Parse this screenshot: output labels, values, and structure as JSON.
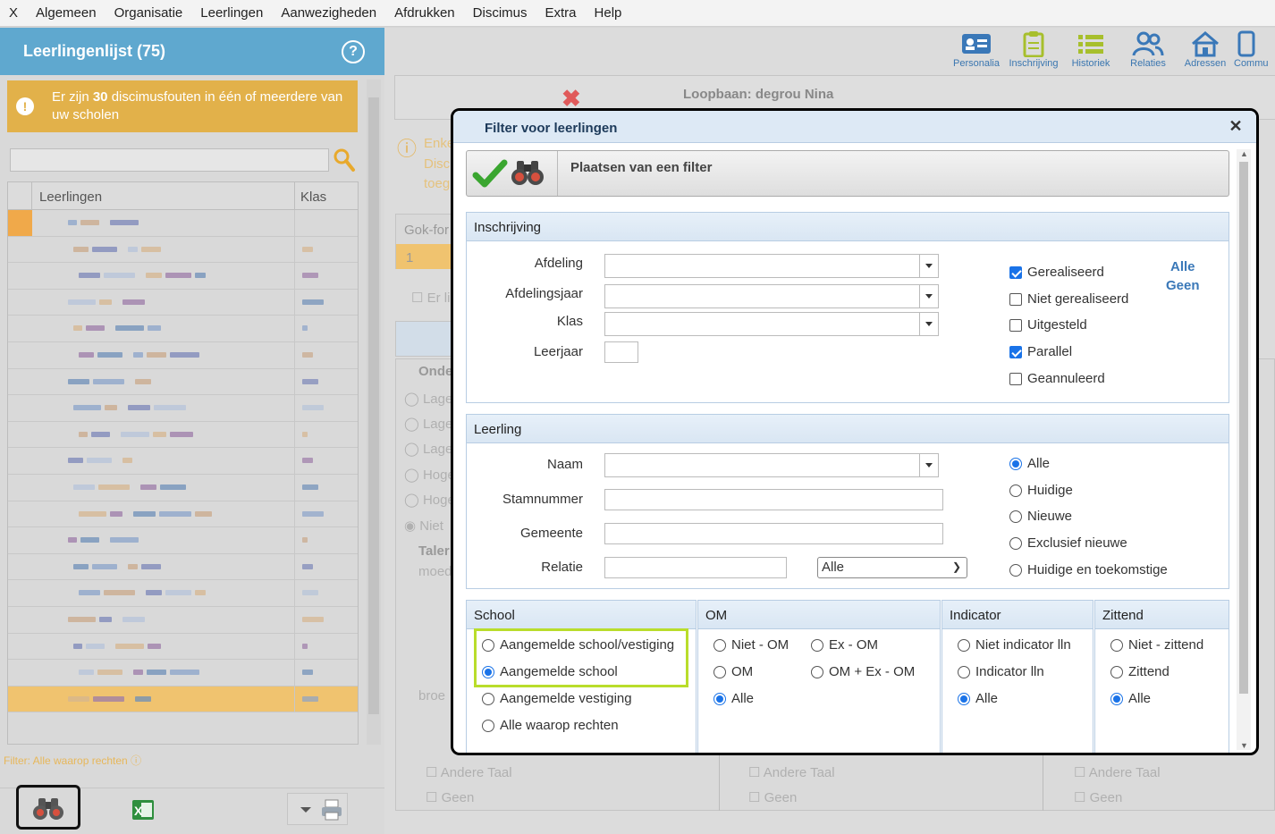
{
  "menu": [
    "X",
    "Algemeen",
    "Organisatie",
    "Leerlingen",
    "Aanwezigheden",
    "Afdrukken",
    "Discimus",
    "Extra",
    "Help"
  ],
  "left": {
    "title": "Leerlingenlijst (75)",
    "warning_pre": "Er zijn ",
    "warning_count": "30",
    "warning_post": " discimusfouten in één of meerdere van uw scholen",
    "col_name": "Leerlingen",
    "col_class": "Klas",
    "filter_note": "Filter: Alle waarop rechten"
  },
  "toolbar": [
    "Personalia",
    "Inschrijving",
    "Historiek",
    "Relaties",
    "Adressen",
    "Commu"
  ],
  "background": {
    "loopbaan": "Loopbaan: degrou Nina",
    "enkel": "Enke",
    "disc": "Disc",
    "toeg": "toeg",
    "gok": "Gok-for",
    "one": "1",
    "er": "Er li",
    "onde": "Onde",
    "lage1": "Lage",
    "lage2": "Lage",
    "lage3": "Lage",
    "hoge1": "Hoge",
    "hoge2": "Hoge",
    "niet": "Niet",
    "talen": "Taler",
    "moed": "moed",
    "broe": "broe",
    "andere_taal": "Andere Taal",
    "geen": "Geen"
  },
  "modal": {
    "title": "Filter voor leerlingen",
    "place_filter": "Plaatsen van een filter",
    "inschrijving": {
      "header": "Inschrijving",
      "afdeling": "Afdeling",
      "afdelingsjaar": "Afdelingsjaar",
      "klas": "Klas",
      "leerjaar": "Leerjaar",
      "checks": [
        {
          "label": "Gerealiseerd",
          "checked": true
        },
        {
          "label": "Niet gerealiseerd",
          "checked": false
        },
        {
          "label": "Uitgesteld",
          "checked": false
        },
        {
          "label": "Parallel",
          "checked": true
        },
        {
          "label": "Geannuleerd",
          "checked": false
        }
      ],
      "alle": "Alle",
      "geen": "Geen"
    },
    "leerling": {
      "header": "Leerling",
      "naam": "Naam",
      "stamnummer": "Stamnummer",
      "gemeente": "Gemeente",
      "relatie": "Relatie",
      "relatie_value": "Alle",
      "radios": [
        {
          "label": "Alle",
          "checked": true
        },
        {
          "label": "Huidige",
          "checked": false
        },
        {
          "label": "Nieuwe",
          "checked": false
        },
        {
          "label": "Exclusief nieuwe",
          "checked": false
        },
        {
          "label": "Huidige en toekomstige",
          "checked": false
        }
      ]
    },
    "school": {
      "header": "School",
      "options": [
        {
          "label": "Aangemelde school/vestiging",
          "checked": false
        },
        {
          "label": "Aangemelde school",
          "checked": true
        },
        {
          "label": "Aangemelde vestiging",
          "checked": false
        },
        {
          "label": "Alle waarop rechten",
          "checked": false
        }
      ]
    },
    "om": {
      "header": "OM",
      "niet_om": "Niet - OM",
      "ex_om": "Ex - OM",
      "om": "OM",
      "om_ex_om": "OM + Ex - OM",
      "alle": "Alle"
    },
    "indicator": {
      "header": "Indicator",
      "niet": "Niet indicator lln",
      "ind": "Indicator lln",
      "alle": "Alle"
    },
    "zittend": {
      "header": "Zittend",
      "niet": "Niet - zittend",
      "zit": "Zittend",
      "alle": "Alle"
    }
  }
}
